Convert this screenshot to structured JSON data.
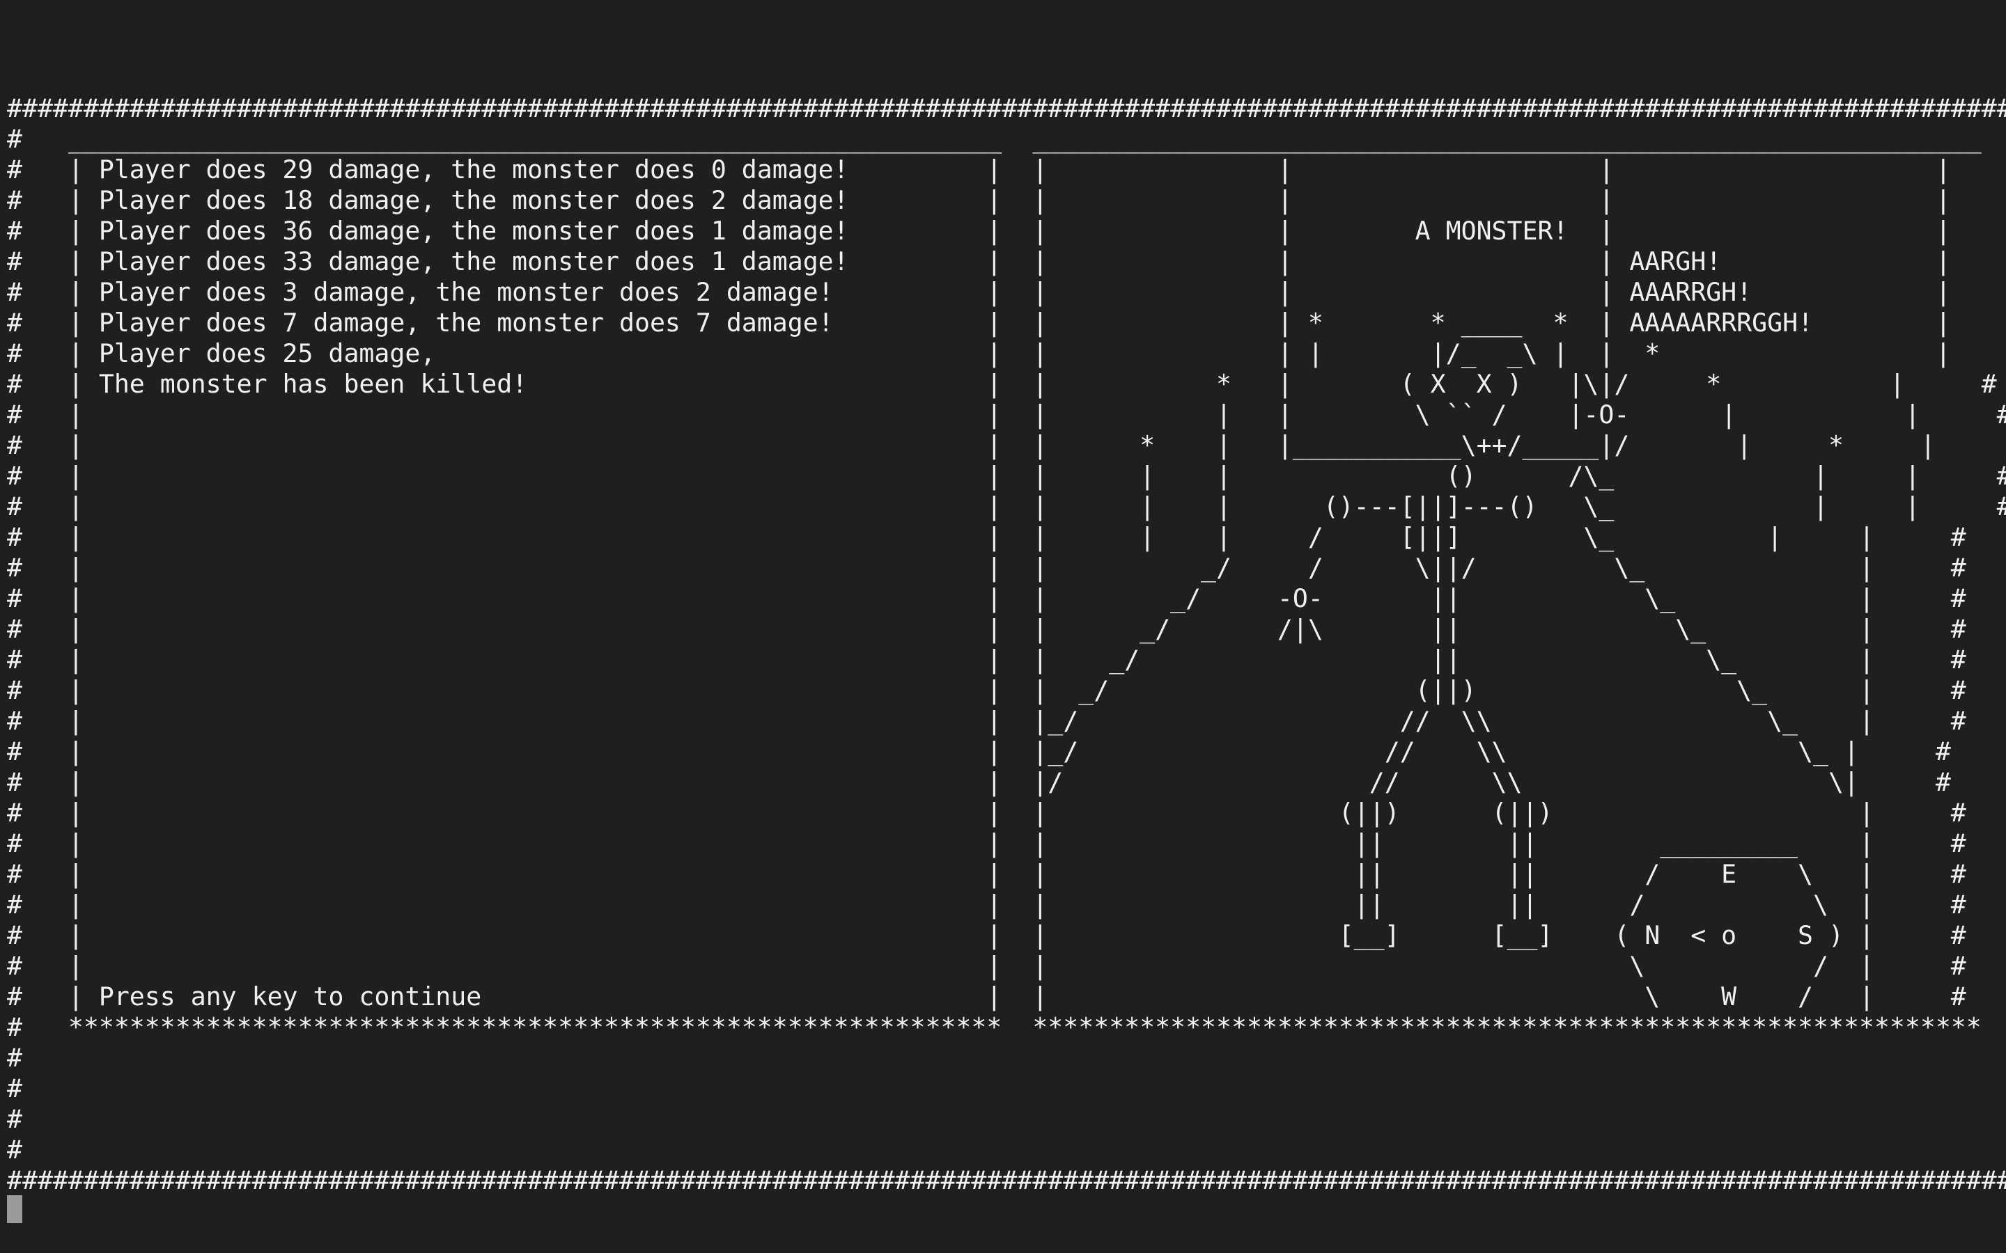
{
  "game": {
    "screen_lines": [
      "#########################################################################################################################################",
      "#   _____________________________________________________________  ______________________________________________________________     #",
      "#   | Player does 29 damage, the monster does 0 damage!         |  |               |                    |                     |     #",
      "#   | Player does 18 damage, the monster does 2 damage!         |  |               |                    |                     |     #",
      "#   | Player does 36 damage, the monster does 1 damage!         |  |               |        A MONSTER!  |                     |     #",
      "#   | Player does 33 damage, the monster does 1 damage!         |  |               |                    | AARGH!              |     #",
      "#   | Player does 3 damage, the monster does 2 damage!          |  |               |                    | AAARRGH!            |     #",
      "#   | Player does 7 damage, the monster does 7 damage!          |  |               | *       * ____  *  | AAAAARRRGGH!        |     #",
      "#   | Player does 25 damage,                                    |  |               | |       |/_  _\\ |  |  *                  |     #",
      "#   | The monster has been killed!                              |  |           *   |       ( X  X )   |\\|/     *           |     #",
      "#   |                                                           |  |           |   |        \\ `` /    |-O-      |           |     #",
      "#   |                                                           |  |      *    |   |___________\\++/_____|/       |     *     |     #",
      "#   |                                                           |  |      |    |              ()      /\\_             |     |     #",
      "#   |                                                           |  |      |    |      ()---[||]---()   \\_             |     |     #",
      "#   |                                                           |  |      |    |     /     [||]        \\_          |     |     #",
      "#   |                                                           |  |          _/     /      \\||/         \\_              |     #",
      "#   |                                                           |  |        _/     -O-       ||            \\_            |     #",
      "#   |                                                           |  |      _/       /|\\       ||              \\_          |     #",
      "#   |                                                           |  |    _/                   ||                \\_        |     #",
      "#   |                                                           |  |  _/                    (||)                 \\_      |     #",
      "#   |                                                           |  |_/                     //  \\\\                  \\_    |     #",
      "#   |                                                           |  |_/                    //    \\\\                   \\_ |     #",
      "#   |                                                           |  |/                    //      \\\\                    \\|     #",
      "#   |                                                           |  |                   (||)      (||)                    |     #",
      "#   |                                                           |  |                    ||        ||        _________    |     #",
      "#   |                                                           |  |                    ||        ||       /    E    \\   |     #",
      "#   |                                                           |  |                    ||        ||      /           \\  |     #",
      "#   |                                                           |  |                   [__]      [__]    ( N  < o    S ) |     #",
      "#   |                                                           |  |                                      \\           /  |     #",
      "#   | Press any key to continue                                 |  |                                       \\    W    /   |     #",
      "#   *************************************************************  **************************************************************     #",
      "#                                                                                                                                      #",
      "#                                                                                                                                      #",
      "#                                                                                                                                      #",
      "#                                                                                                                                      #",
      "########################################################################################################################################"
    ]
  }
}
